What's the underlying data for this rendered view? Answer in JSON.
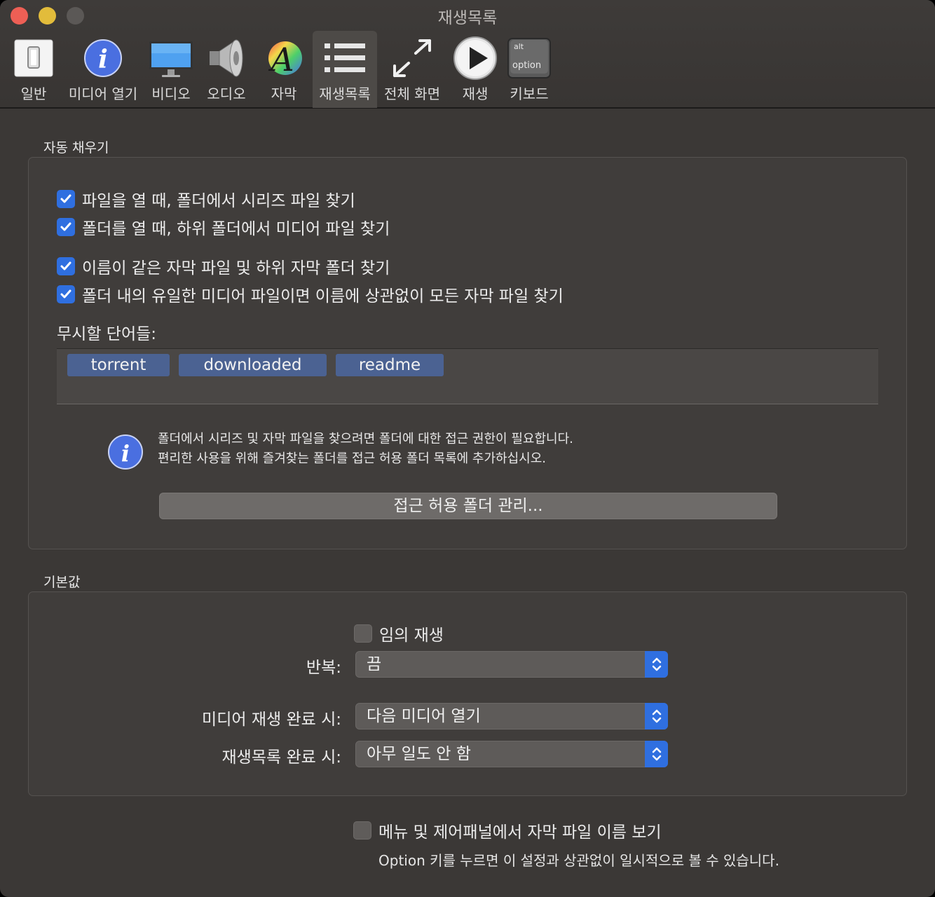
{
  "window": {
    "title": "재생목록"
  },
  "toolbar": {
    "items": [
      {
        "label": "일반",
        "icon": "switch-icon"
      },
      {
        "label": "미디어 열기",
        "icon": "info-icon"
      },
      {
        "label": "비디오",
        "icon": "monitor-icon"
      },
      {
        "label": "오디오",
        "icon": "speaker-icon"
      },
      {
        "label": "자막",
        "icon": "font-icon"
      },
      {
        "label": "재생목록",
        "icon": "list-icon",
        "selected": true
      },
      {
        "label": "전체 화면",
        "icon": "fullscreen-icon"
      },
      {
        "label": "재생",
        "icon": "play-icon"
      },
      {
        "label": "키보드",
        "icon": "keyboard-icon"
      }
    ],
    "keycap": {
      "top": "alt",
      "bottom": "option"
    }
  },
  "autofill": {
    "title": "자동 채우기",
    "checkboxes": [
      {
        "label": "파일을 열 때, 폴더에서 시리즈 파일 찾기",
        "checked": true
      },
      {
        "label": "폴더를 열 때, 하위 폴더에서 미디어 파일 찾기",
        "checked": true
      },
      {
        "label": "이름이 같은 자막 파일 및 하위 자막 폴더 찾기",
        "checked": true
      },
      {
        "label": "폴더 내의 유일한 미디어 파일이면 이름에 상관없이 모든 자막 파일 찾기",
        "checked": true
      }
    ],
    "ignore_label": "무시할 단어들:",
    "ignore_words": [
      "torrent",
      "downloaded",
      "readme"
    ],
    "info_line1": "폴더에서 시리즈 및 자막 파일을 찾으려면 폴더에 대한 접근 권한이 필요합니다.",
    "info_line2": "편리한 사용을 위해 즐겨찾는 폴더를 접근 허용 폴더 목록에 추가하십시오.",
    "manage_button": "접근 허용 폴더 관리..."
  },
  "defaults": {
    "title": "기본값",
    "shuffle_label": "임의 재생",
    "shuffle_checked": false,
    "repeat_label": "반복:",
    "repeat_value": "끔",
    "media_end_label": "미디어 재생 완료 시:",
    "media_end_value": "다음 미디어 열기",
    "playlist_end_label": "재생목록 완료 시:",
    "playlist_end_value": "아무 일도 안 함"
  },
  "footer": {
    "show_sub_label": "메뉴 및 제어패널에서 자막 파일 이름 보기",
    "show_sub_checked": false,
    "hint": "Option 키를 누르면 이 설정과 상관없이 일시적으로 볼 수 있습니다."
  },
  "colors": {
    "accent": "#2f6fe0",
    "window_bg": "#3b3836",
    "token_bg": "#4b6292"
  }
}
